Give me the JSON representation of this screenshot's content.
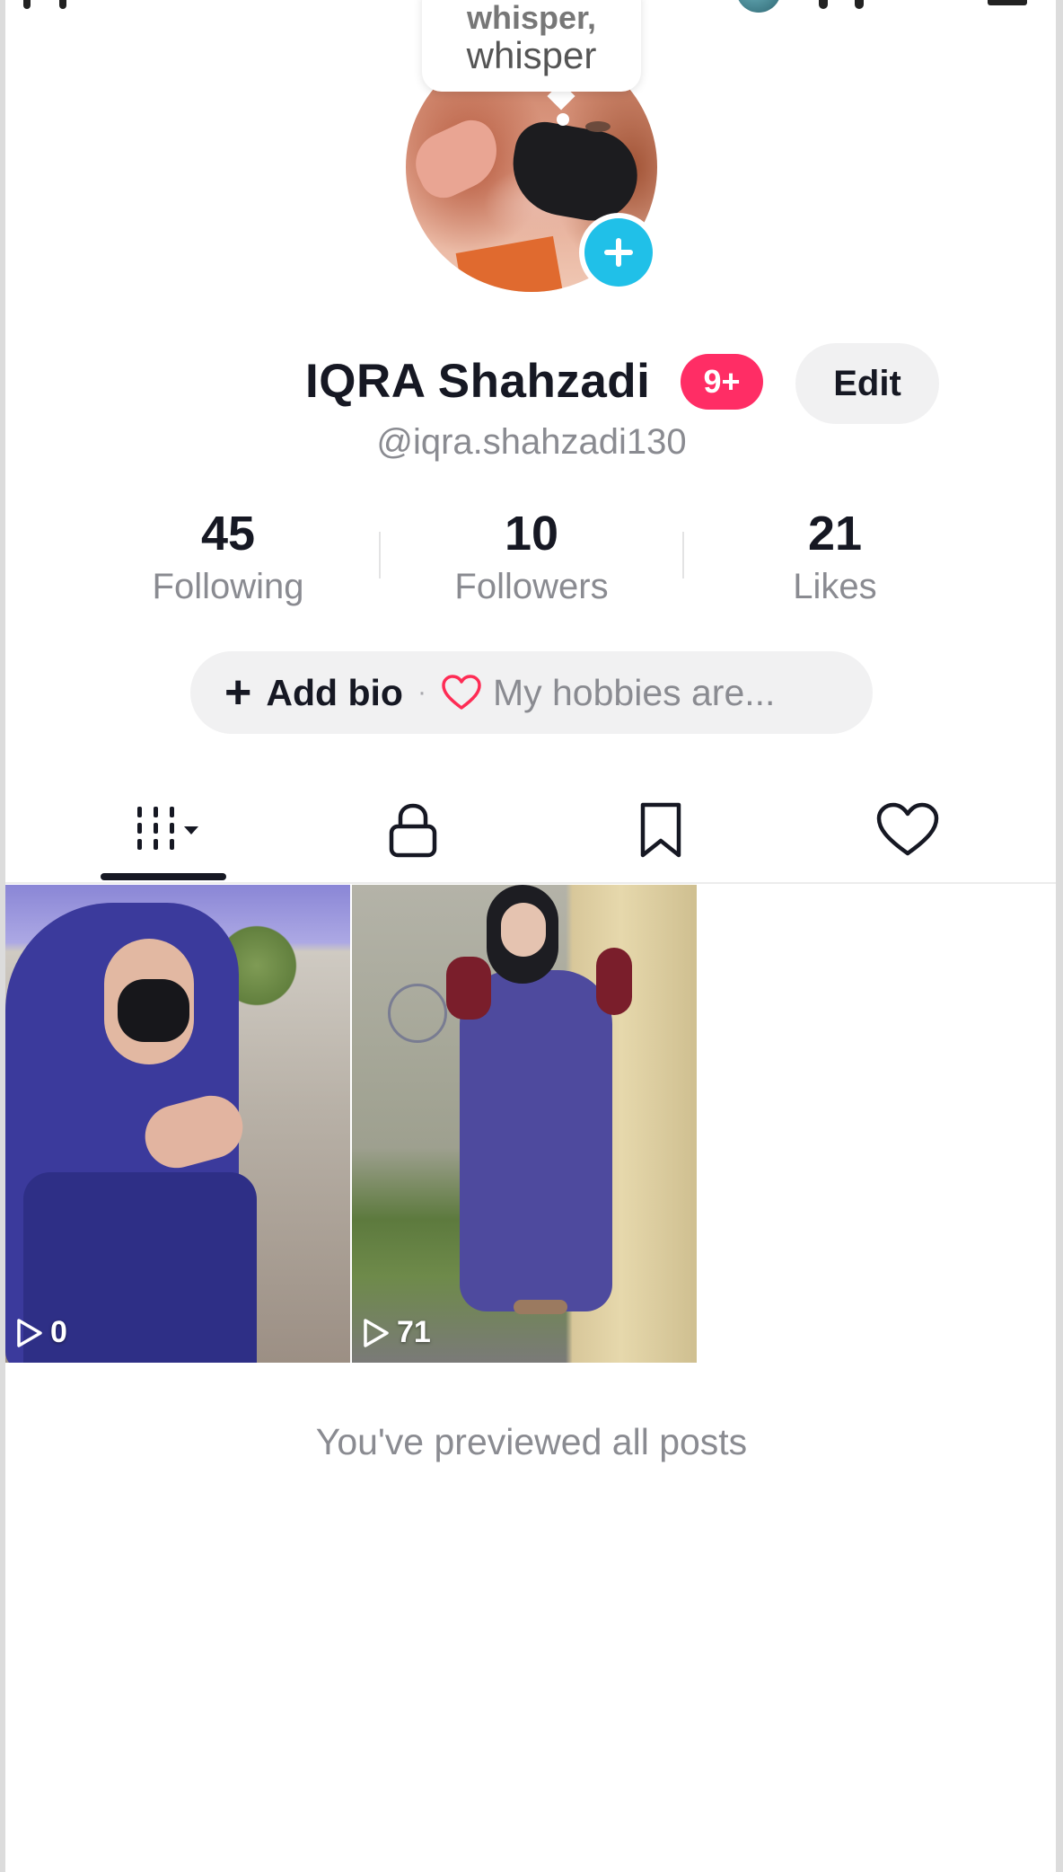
{
  "whisper": {
    "line1": "whisper,",
    "line2": "whisper"
  },
  "profile": {
    "display_name": "IQRA Shahzadi",
    "notification_badge": "9+",
    "edit_label": "Edit",
    "username": "@iqra.shahzadi130"
  },
  "stats": [
    {
      "value": "45",
      "label": "Following"
    },
    {
      "value": "10",
      "label": "Followers"
    },
    {
      "value": "21",
      "label": "Likes"
    }
  ],
  "bio": {
    "plus": "+",
    "add_label": "Add bio",
    "separator": "·",
    "hint": "My hobbies are..."
  },
  "tabs": [
    {
      "icon": "grid-dropdown-icon",
      "active": true
    },
    {
      "icon": "lock-icon",
      "active": false
    },
    {
      "icon": "bookmark-icon",
      "active": false
    },
    {
      "icon": "heart-icon",
      "active": false
    }
  ],
  "posts": [
    {
      "views": "0"
    },
    {
      "views": "71"
    }
  ],
  "end_message": "You've previewed all posts",
  "colors": {
    "accent_pink": "#ff2d65",
    "plus_blue": "#20c0e8",
    "muted_text": "#8a8b91",
    "primary_text": "#161823"
  }
}
